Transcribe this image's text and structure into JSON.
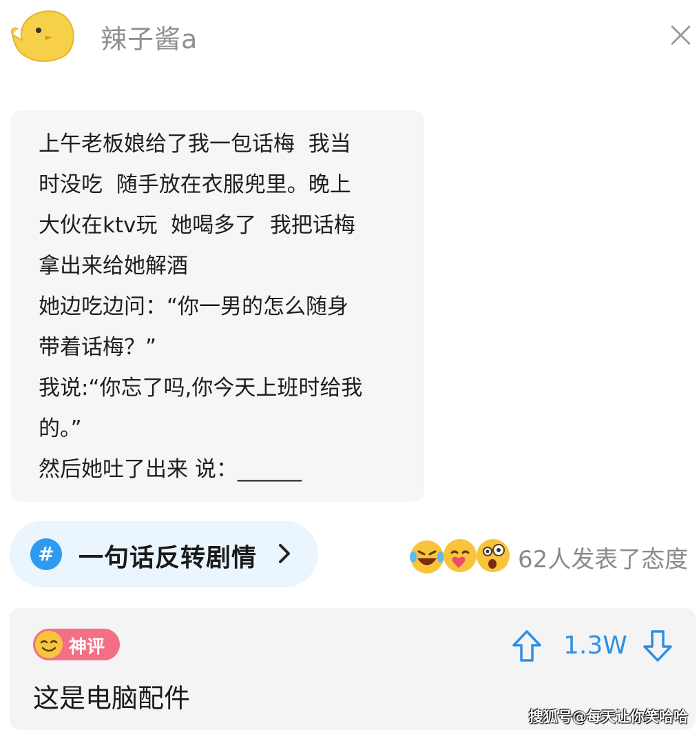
{
  "header": {
    "username": "辣子酱a",
    "avatar_icon": "chick-avatar",
    "close_icon": "close-icon"
  },
  "post": {
    "lines": [
      "上午老板娘给了我一包话梅  我当",
      "时没吃  随手放在衣服兜里。晚上",
      "大伙在ktv玩  她喝多了  我把话梅",
      "拿出来给她解酒",
      "她边吃边问：“你一男的怎么随身",
      "带着话梅？”",
      "我说:“你忘了吗,你今天上班时给我",
      "的。”",
      "然后她吐了出来 说：______"
    ]
  },
  "topic": {
    "icon": "#",
    "label": "一句话反转剧情",
    "chevron_icon": "chevron-right-icon"
  },
  "reactions": {
    "icons": [
      "laugh-cry-emoji",
      "love-hug-emoji",
      "shocked-emoji"
    ],
    "text": "62人发表了态度"
  },
  "comment": {
    "badge": "神评",
    "badge_icon": "smiling-face-icon",
    "votes": "1.3W",
    "text": "这是电脑配件"
  },
  "watermark": "搜狐号@每天让你笑哈哈",
  "colors": {
    "accent_blue": "#2f9bf0",
    "badge_pink": "#f36f85",
    "avatar_yellow": "#f7d04a"
  }
}
